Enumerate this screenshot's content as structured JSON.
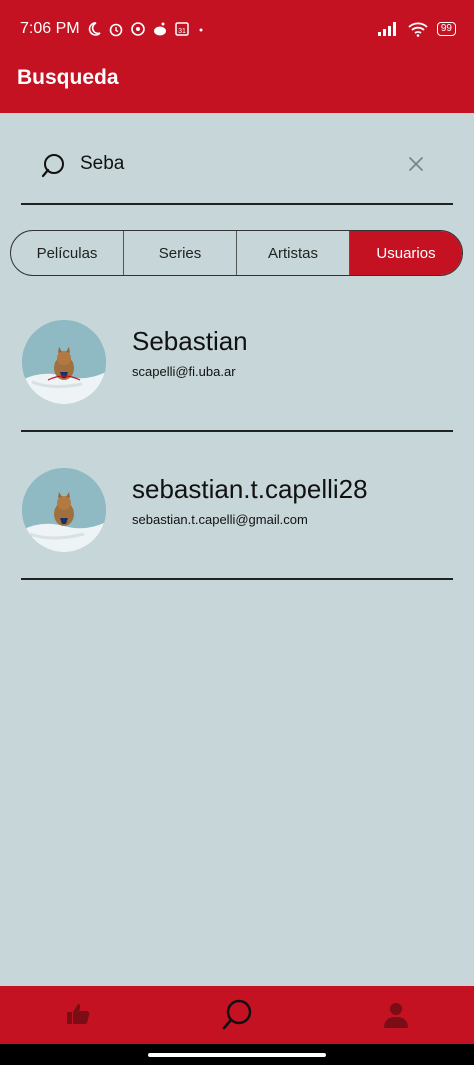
{
  "status": {
    "time": "7:06 PM",
    "battery": "99"
  },
  "header": {
    "title": "Busqueda"
  },
  "search": {
    "value": "Seba"
  },
  "tabs": [
    {
      "label": "Películas",
      "active": false
    },
    {
      "label": "Series",
      "active": false
    },
    {
      "label": "Artistas",
      "active": false
    },
    {
      "label": "Usuarios",
      "active": true
    }
  ],
  "users": [
    {
      "name": "Sebastian",
      "email": "scapelli@fi.uba.ar"
    },
    {
      "name": "sebastian.t.capelli28",
      "email": "sebastian.t.capelli@gmail.com"
    }
  ],
  "bottom_nav": [
    {
      "icon": "thumbs-up-icon"
    },
    {
      "icon": "search-icon"
    },
    {
      "icon": "profile-icon"
    }
  ],
  "colors": {
    "brand": "#c41222",
    "background": "#c7d6d9"
  }
}
